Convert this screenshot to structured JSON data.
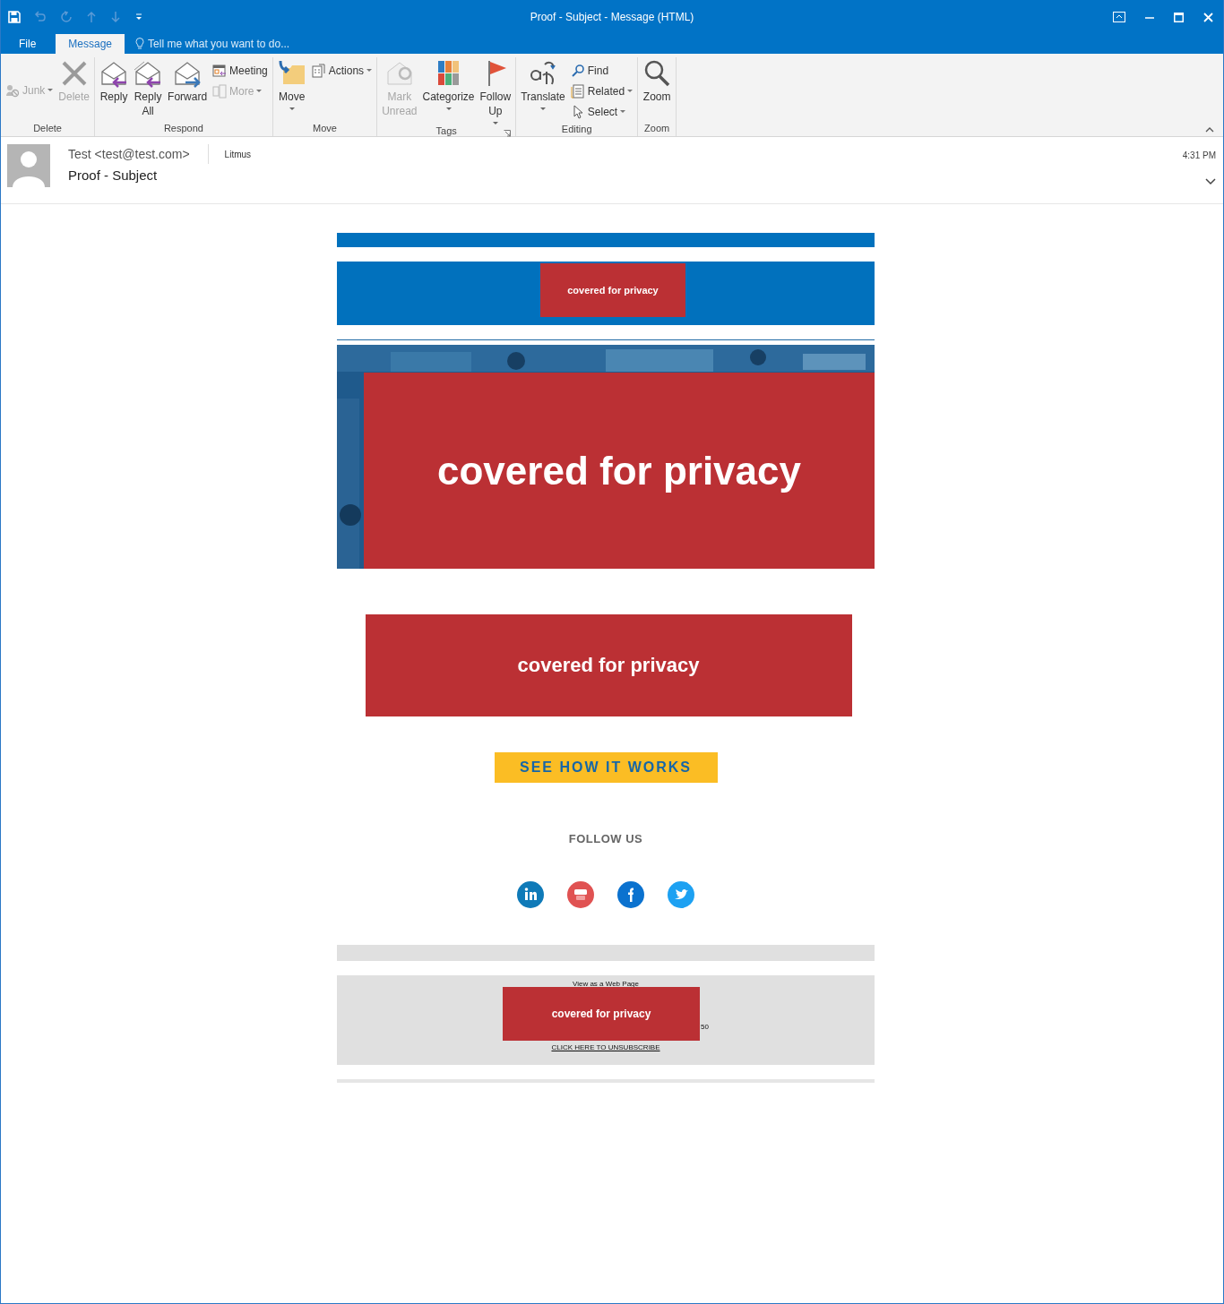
{
  "window": {
    "title": "Proof - Subject - Message (HTML)"
  },
  "tabs": [
    {
      "label": "File",
      "selected": false
    },
    {
      "label": "Message",
      "selected": true
    }
  ],
  "tell_me": {
    "placeholder": "Tell me what you want to do..."
  },
  "ribbon": {
    "groups": [
      {
        "label": "Delete",
        "items": [
          {
            "label": "Junk",
            "kind": "small",
            "disabled": true,
            "dropdown": true
          },
          {
            "label": "Delete",
            "kind": "large",
            "disabled": true,
            "dropdown": false
          }
        ]
      },
      {
        "label": "Respond",
        "items": [
          {
            "label": "Reply",
            "kind": "large",
            "disabled": false,
            "dropdown": false
          },
          {
            "label": "Reply All",
            "kind": "large",
            "disabled": false,
            "dropdown": false
          },
          {
            "label": "Forward",
            "kind": "large",
            "disabled": false,
            "dropdown": false
          },
          {
            "label": "Meeting",
            "kind": "small",
            "disabled": false,
            "dropdown": false
          },
          {
            "label": "More",
            "kind": "small",
            "disabled": true,
            "dropdown": true
          }
        ]
      },
      {
        "label": "Move",
        "items": [
          {
            "label": "Move",
            "kind": "large",
            "disabled": false,
            "dropdown": true
          },
          {
            "label": "Actions",
            "kind": "small",
            "disabled": false,
            "dropdown": true
          }
        ]
      },
      {
        "label": "Tags",
        "launcher": true,
        "items": [
          {
            "label": "Mark Unread",
            "kind": "large",
            "disabled": true,
            "dropdown": false
          },
          {
            "label": "Categorize",
            "kind": "large",
            "disabled": false,
            "dropdown": true
          },
          {
            "label": "Follow Up",
            "kind": "large",
            "disabled": false,
            "dropdown": true
          }
        ]
      },
      {
        "label": "Editing",
        "items": [
          {
            "label": "Translate",
            "kind": "large",
            "disabled": false,
            "dropdown": true
          },
          {
            "label": "Find",
            "kind": "small",
            "disabled": false,
            "dropdown": false
          },
          {
            "label": "Related",
            "kind": "small",
            "disabled": false,
            "dropdown": true
          },
          {
            "label": "Select",
            "kind": "small",
            "disabled": false,
            "dropdown": true
          }
        ]
      },
      {
        "label": "Zoom",
        "items": [
          {
            "label": "Zoom",
            "kind": "large",
            "disabled": false,
            "dropdown": false
          }
        ]
      }
    ]
  },
  "message": {
    "sender": "Test <test@test.com>",
    "recipient": "Litmus",
    "subject": "Proof - Subject",
    "time": "4:31 PM"
  },
  "email": {
    "banner_cover": "covered for privacy",
    "hero": {
      "kind": "picture",
      "cover": "covered for privacy"
    },
    "card_cover": "covered for privacy",
    "cta": "SEE HOW IT WORKS",
    "follow_heading": "FOLLOW US",
    "social": [
      {
        "kind": "linkedin"
      },
      {
        "kind": "youtube"
      },
      {
        "kind": "facebook"
      },
      {
        "kind": "twitter"
      }
    ],
    "footer": {
      "web_link": "View as a Web Page",
      "fragment": "50",
      "cover": "covered for privacy",
      "unsubscribe": "CLICK HERE TO UNSUBSCRIBE"
    }
  }
}
